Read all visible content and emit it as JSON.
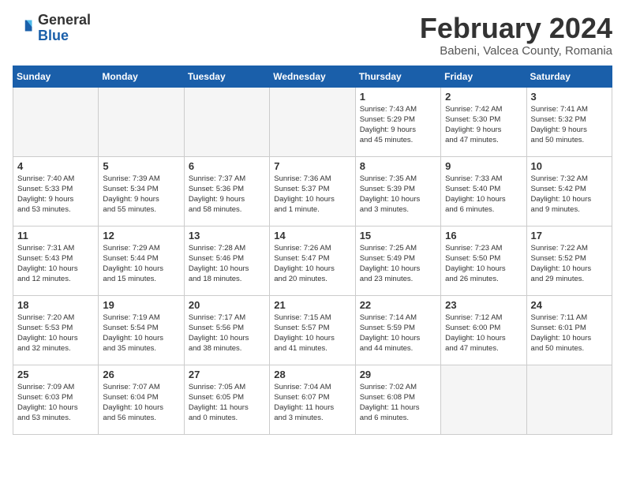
{
  "header": {
    "logo": {
      "general": "General",
      "blue": "Blue"
    },
    "title": "February 2024",
    "location": "Babeni, Valcea County, Romania"
  },
  "weekdays": [
    "Sunday",
    "Monday",
    "Tuesday",
    "Wednesday",
    "Thursday",
    "Friday",
    "Saturday"
  ],
  "weeks": [
    [
      {
        "day": "",
        "info": ""
      },
      {
        "day": "",
        "info": ""
      },
      {
        "day": "",
        "info": ""
      },
      {
        "day": "",
        "info": ""
      },
      {
        "day": "1",
        "info": "Sunrise: 7:43 AM\nSunset: 5:29 PM\nDaylight: 9 hours\nand 45 minutes."
      },
      {
        "day": "2",
        "info": "Sunrise: 7:42 AM\nSunset: 5:30 PM\nDaylight: 9 hours\nand 47 minutes."
      },
      {
        "day": "3",
        "info": "Sunrise: 7:41 AM\nSunset: 5:32 PM\nDaylight: 9 hours\nand 50 minutes."
      }
    ],
    [
      {
        "day": "4",
        "info": "Sunrise: 7:40 AM\nSunset: 5:33 PM\nDaylight: 9 hours\nand 53 minutes."
      },
      {
        "day": "5",
        "info": "Sunrise: 7:39 AM\nSunset: 5:34 PM\nDaylight: 9 hours\nand 55 minutes."
      },
      {
        "day": "6",
        "info": "Sunrise: 7:37 AM\nSunset: 5:36 PM\nDaylight: 9 hours\nand 58 minutes."
      },
      {
        "day": "7",
        "info": "Sunrise: 7:36 AM\nSunset: 5:37 PM\nDaylight: 10 hours\nand 1 minute."
      },
      {
        "day": "8",
        "info": "Sunrise: 7:35 AM\nSunset: 5:39 PM\nDaylight: 10 hours\nand 3 minutes."
      },
      {
        "day": "9",
        "info": "Sunrise: 7:33 AM\nSunset: 5:40 PM\nDaylight: 10 hours\nand 6 minutes."
      },
      {
        "day": "10",
        "info": "Sunrise: 7:32 AM\nSunset: 5:42 PM\nDaylight: 10 hours\nand 9 minutes."
      }
    ],
    [
      {
        "day": "11",
        "info": "Sunrise: 7:31 AM\nSunset: 5:43 PM\nDaylight: 10 hours\nand 12 minutes."
      },
      {
        "day": "12",
        "info": "Sunrise: 7:29 AM\nSunset: 5:44 PM\nDaylight: 10 hours\nand 15 minutes."
      },
      {
        "day": "13",
        "info": "Sunrise: 7:28 AM\nSunset: 5:46 PM\nDaylight: 10 hours\nand 18 minutes."
      },
      {
        "day": "14",
        "info": "Sunrise: 7:26 AM\nSunset: 5:47 PM\nDaylight: 10 hours\nand 20 minutes."
      },
      {
        "day": "15",
        "info": "Sunrise: 7:25 AM\nSunset: 5:49 PM\nDaylight: 10 hours\nand 23 minutes."
      },
      {
        "day": "16",
        "info": "Sunrise: 7:23 AM\nSunset: 5:50 PM\nDaylight: 10 hours\nand 26 minutes."
      },
      {
        "day": "17",
        "info": "Sunrise: 7:22 AM\nSunset: 5:52 PM\nDaylight: 10 hours\nand 29 minutes."
      }
    ],
    [
      {
        "day": "18",
        "info": "Sunrise: 7:20 AM\nSunset: 5:53 PM\nDaylight: 10 hours\nand 32 minutes."
      },
      {
        "day": "19",
        "info": "Sunrise: 7:19 AM\nSunset: 5:54 PM\nDaylight: 10 hours\nand 35 minutes."
      },
      {
        "day": "20",
        "info": "Sunrise: 7:17 AM\nSunset: 5:56 PM\nDaylight: 10 hours\nand 38 minutes."
      },
      {
        "day": "21",
        "info": "Sunrise: 7:15 AM\nSunset: 5:57 PM\nDaylight: 10 hours\nand 41 minutes."
      },
      {
        "day": "22",
        "info": "Sunrise: 7:14 AM\nSunset: 5:59 PM\nDaylight: 10 hours\nand 44 minutes."
      },
      {
        "day": "23",
        "info": "Sunrise: 7:12 AM\nSunset: 6:00 PM\nDaylight: 10 hours\nand 47 minutes."
      },
      {
        "day": "24",
        "info": "Sunrise: 7:11 AM\nSunset: 6:01 PM\nDaylight: 10 hours\nand 50 minutes."
      }
    ],
    [
      {
        "day": "25",
        "info": "Sunrise: 7:09 AM\nSunset: 6:03 PM\nDaylight: 10 hours\nand 53 minutes."
      },
      {
        "day": "26",
        "info": "Sunrise: 7:07 AM\nSunset: 6:04 PM\nDaylight: 10 hours\nand 56 minutes."
      },
      {
        "day": "27",
        "info": "Sunrise: 7:05 AM\nSunset: 6:05 PM\nDaylight: 11 hours\nand 0 minutes."
      },
      {
        "day": "28",
        "info": "Sunrise: 7:04 AM\nSunset: 6:07 PM\nDaylight: 11 hours\nand 3 minutes."
      },
      {
        "day": "29",
        "info": "Sunrise: 7:02 AM\nSunset: 6:08 PM\nDaylight: 11 hours\nand 6 minutes."
      },
      {
        "day": "",
        "info": ""
      },
      {
        "day": "",
        "info": ""
      }
    ]
  ]
}
